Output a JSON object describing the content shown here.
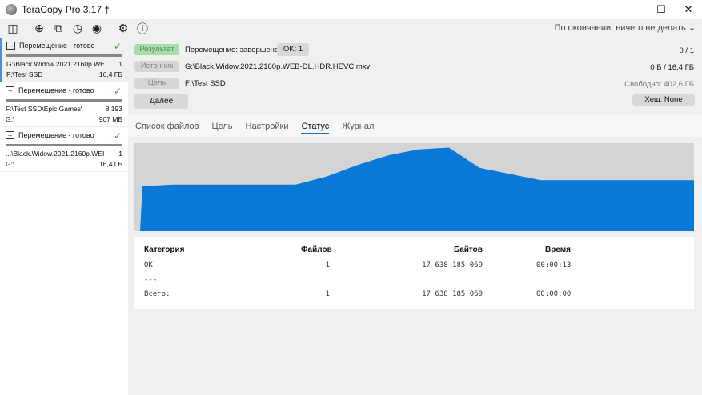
{
  "window": {
    "title": "TeraCopy Pro 3.17 †",
    "minimize": "—",
    "maximize": "☐",
    "close": "✕"
  },
  "toolbar": {
    "icons": [
      "sidebar-toggle-icon",
      "add-icon",
      "copy-icon",
      "history-icon",
      "account-icon",
      "gear-icon",
      "info-icon"
    ],
    "on_finish": "По окончании: ничего не делать ⌄"
  },
  "jobs": [
    {
      "status": "Перемещение - готово",
      "source": "G:\\Black.Widow.2021.2160p.WE",
      "count": "1",
      "target": "F:\\Test SSD",
      "size": "16,4 ГБ"
    },
    {
      "status": "Перемещение - готово",
      "source": "F:\\Test SSD\\Epic Games\\",
      "count": "8 193",
      "target": "G:\\",
      "size": "907 МБ"
    },
    {
      "status": "Перемещение - готово",
      "source": "...\\Black.Widow.2021.2160p.WEI",
      "count": "1",
      "target": "G:\\",
      "size": "16,4 ГБ"
    }
  ],
  "details": {
    "result_label": "Результат",
    "result_text": "Перемещение: завершено",
    "ok_badge": "OK: 1",
    "progress_files": "0 / 1",
    "source_label": "Источник",
    "source_path": "G:\\Black.Widow.2021.2160p.WEB-DL.HDR.HEVC.mkv",
    "bytes": "0 Б / 16,4 ГБ",
    "target_label": "Цель",
    "target_path": "F:\\Test SSD",
    "free": "Свободно: 402,6 ГБ",
    "next_button": "Далее",
    "hash_button": "Хеш: None"
  },
  "tabs": [
    "Список файлов",
    "Цель",
    "Настройки",
    "Статус",
    "Журнал"
  ],
  "graph": {
    "color": "#0a78d7",
    "speed_profile": [
      0,
      0.51,
      0.53,
      0.53,
      0.53,
      0.53,
      0.53,
      0.62,
      0.75,
      0.86,
      0.93,
      0.95,
      0.72,
      0.65,
      0.58,
      0.58,
      0.58,
      0.58,
      0.58,
      0.58
    ]
  },
  "stats": {
    "headers": [
      "Категория",
      "Файлов",
      "Байтов",
      "Время"
    ],
    "rows": [
      [
        "OK",
        "1",
        "17 638 185 069",
        "00:00:13"
      ],
      [
        "---",
        "",
        "",
        ""
      ],
      [
        "Всего:",
        "1",
        "17 638 185 069",
        "00:00:00"
      ]
    ]
  }
}
